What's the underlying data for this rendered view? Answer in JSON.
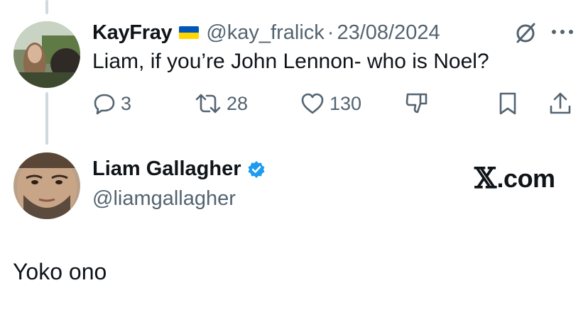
{
  "parent_tweet": {
    "display_name": "KayFray",
    "flag_icon": "ukraine-flag-icon",
    "handle": "@kay_fralick",
    "separator": "·",
    "date": "23/08/2024",
    "text": "Liam, if you’re John Lennon- who is Noel?",
    "replies": "3",
    "retweets": "28",
    "likes": "130"
  },
  "main_tweet": {
    "display_name": "Liam Gallagher",
    "handle": "@liamgallagher",
    "verified_icon": "verified-badge-icon",
    "text": "Yoko ono"
  },
  "watermark": {
    "logo": "𝕏",
    "suffix": ".com"
  },
  "colors": {
    "text": "#0f1419",
    "muted": "#536471",
    "verified": "#1d9bf0",
    "thread_line": "#cfd9de"
  }
}
